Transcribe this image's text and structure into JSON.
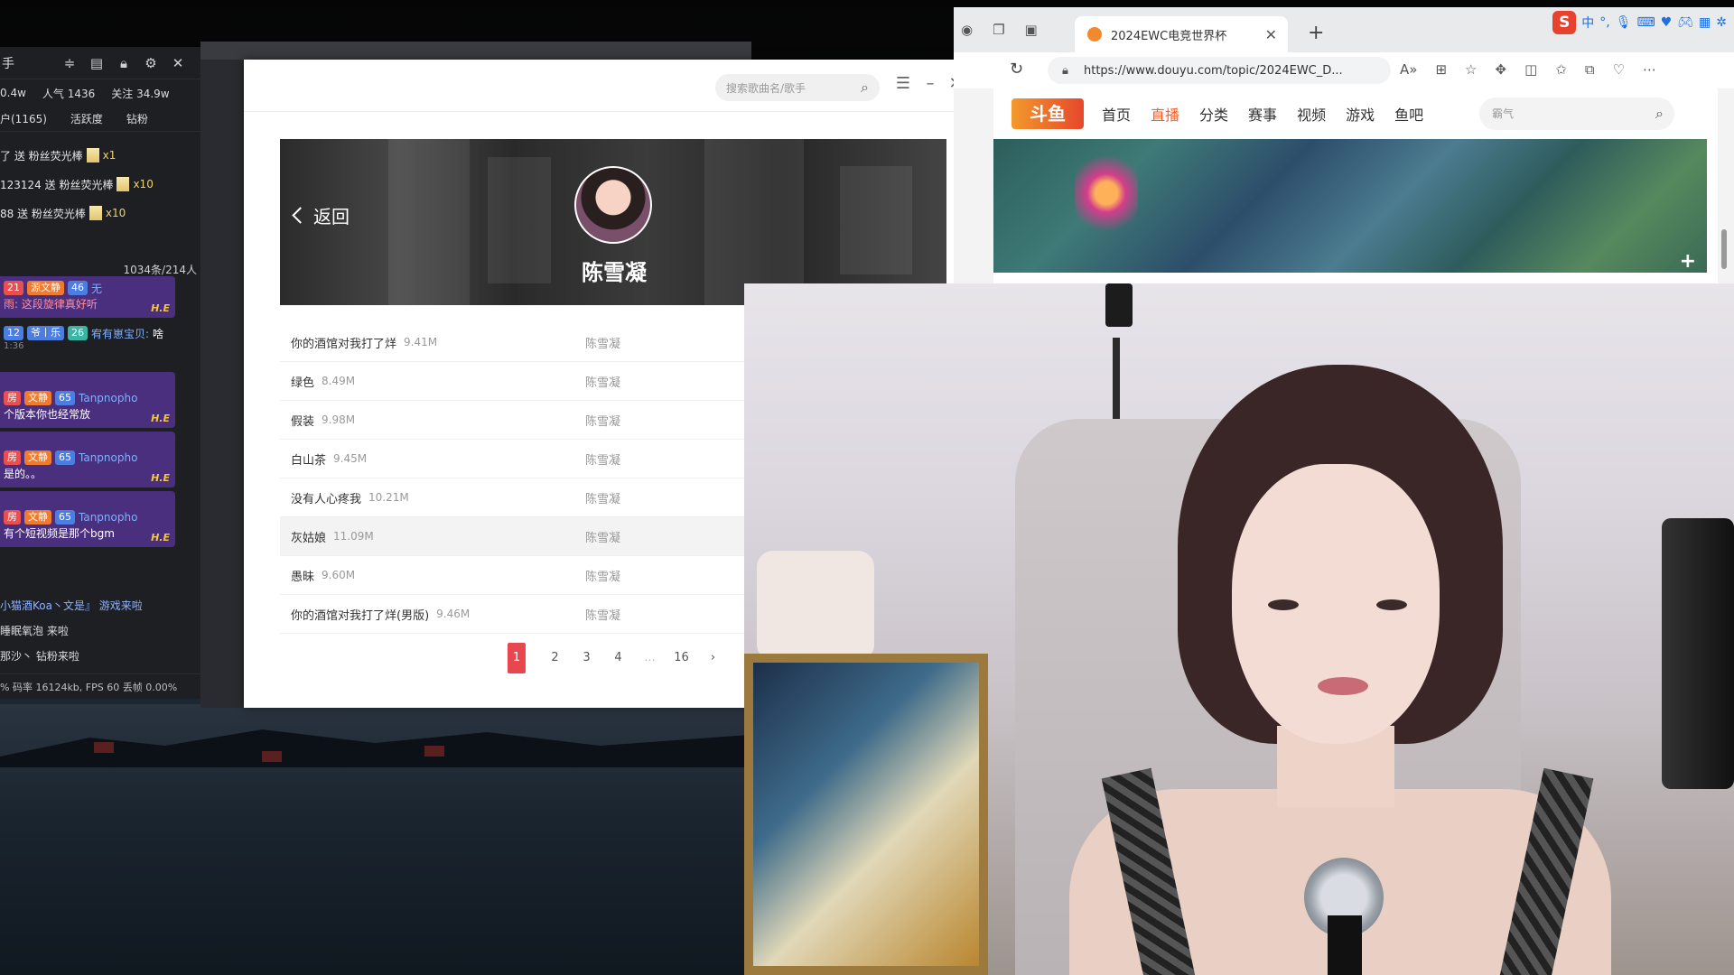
{
  "chat_panel": {
    "title": "手",
    "stats": [
      "0.4w",
      "人气 1436",
      "关注 34.9w"
    ],
    "tabs": [
      "户(1165)",
      "活跃度",
      "钻粉"
    ],
    "gifts": [
      {
        "text": "了 送 粉丝荧光棒",
        "count": "x1"
      },
      {
        "text": "123124 送 粉丝荧光棒",
        "count": "x10"
      },
      {
        "text": "88 送 粉丝荧光棒",
        "count": "x10"
      }
    ],
    "online": "1034条/214人",
    "messages": [
      {
        "badges": [
          "21",
          "源文静",
          "46",
          "无"
        ],
        "text": "雨: 这段旋律真好听"
      },
      {
        "badges": [
          "12",
          "爷丨乐",
          "26"
        ],
        "name": "宥有崽宝贝:",
        "text": "啥"
      },
      {
        "badges": [
          "房",
          "文静",
          "65"
        ],
        "name": "Tanpnopho",
        "text": "个版本你也经常放"
      },
      {
        "badges": [
          "房",
          "文静",
          "65"
        ],
        "name": "Tanpnopho",
        "text": "是的。。"
      },
      {
        "badges": [
          "房",
          "文静",
          "65"
        ],
        "name": "Tanpnopho",
        "text": "有个短视频是那个bgm"
      }
    ],
    "plain_lines": [
      "小猫酒Koa丶文是』 游戏来啦",
      "睡眠氧泡 来啦",
      "那沙丶 钻粉来啦"
    ],
    "he_label": "H.E",
    "time_stamp": "1:36",
    "status": "% 码率 16124kb, FPS 60 丢帧 0.00%"
  },
  "music_player": {
    "search_placeholder": "搜索歌曲名/歌手",
    "back_label": "返回",
    "artist_name": "陈雪凝",
    "songs": [
      {
        "title": "你的酒馆对我打了烊",
        "size": "9.41M",
        "artist": "陈雪凝"
      },
      {
        "title": "绿色",
        "size": "8.49M",
        "artist": "陈雪凝"
      },
      {
        "title": "假装",
        "size": "9.98M",
        "artist": "陈雪凝"
      },
      {
        "title": "白山茶",
        "size": "9.45M",
        "artist": "陈雪凝"
      },
      {
        "title": "没有人心疼我",
        "size": "10.21M",
        "artist": "陈雪凝"
      },
      {
        "title": "灰姑娘",
        "size": "11.09M",
        "artist": "陈雪凝"
      },
      {
        "title": "愚昧",
        "size": "9.60M",
        "artist": "陈雪凝"
      },
      {
        "title": "你的酒馆对我打了烊(男版)",
        "size": "9.46M",
        "artist": "陈雪凝"
      }
    ],
    "pager": [
      "1",
      "2",
      "3",
      "4",
      "...",
      "16"
    ],
    "accent": "#e9474f"
  },
  "browser": {
    "tab_title": "2024EWC电竞世界杯",
    "url": "https://www.douyu.com/topic/2024EWC_D...",
    "ime_labels": [
      "中"
    ],
    "site": {
      "logo": "斗鱼",
      "nav": [
        "首页",
        "直播",
        "分类",
        "赛事",
        "视频",
        "游戏",
        "鱼吧"
      ],
      "active_nav": "直播",
      "search_placeholder": "霸气",
      "accent": "#ff5d23"
    }
  }
}
